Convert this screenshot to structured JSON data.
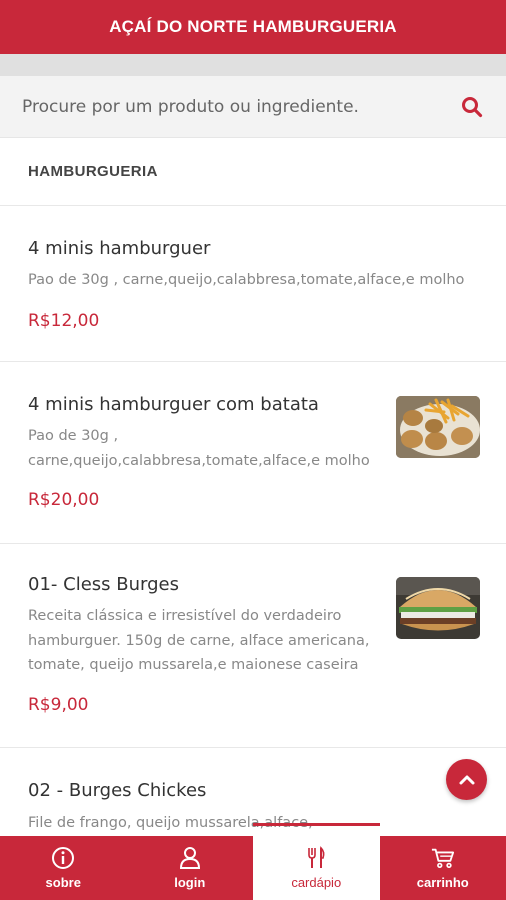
{
  "header": {
    "title": "AÇAÍ DO NORTE HAMBURGUERIA"
  },
  "search": {
    "placeholder": "Procure por um produto ou ingrediente."
  },
  "section": {
    "title": "HAMBURGUERIA"
  },
  "products": [
    {
      "name": "4 minis hamburguer",
      "description_lines": [
        "Pao de 30g , carne,queijo,calabbresa,tomate,alface,e molho"
      ],
      "price": "R$12,00",
      "has_image": false
    },
    {
      "name": "4 minis hamburguer com batata",
      "description_lines": [
        "Pao de 30g ,",
        "carne,queijo,calabbresa,tomate,alface,e molho"
      ],
      "price": "R$20,00",
      "has_image": true,
      "image": "mini-burgers-fries-photo"
    },
    {
      "name": "01- Cless Burges",
      "description_lines": [
        "Receita clássica e irresistível do verdadeiro",
        "hamburguer. 150g de carne, alface americana,",
        "tomate, queijo mussarela,e maionese caseira"
      ],
      "price": "R$9,00",
      "has_image": true,
      "image": "burger-photo"
    },
    {
      "name": "02 - Burges Chickes",
      "description_lines": [
        "File de frango, queijo mussarela,alface,"
      ],
      "price": "",
      "has_image": false
    }
  ],
  "nav": [
    {
      "label": "sobre",
      "icon": "info-icon",
      "active": false
    },
    {
      "label": "login",
      "icon": "user-icon",
      "active": false
    },
    {
      "label": "cardápio",
      "icon": "cutlery-icon",
      "active": true
    },
    {
      "label": "carrinho",
      "icon": "cart-icon",
      "active": false
    }
  ],
  "colors": {
    "brand": "#c8283a",
    "text": "#333333",
    "muted": "#888888"
  }
}
